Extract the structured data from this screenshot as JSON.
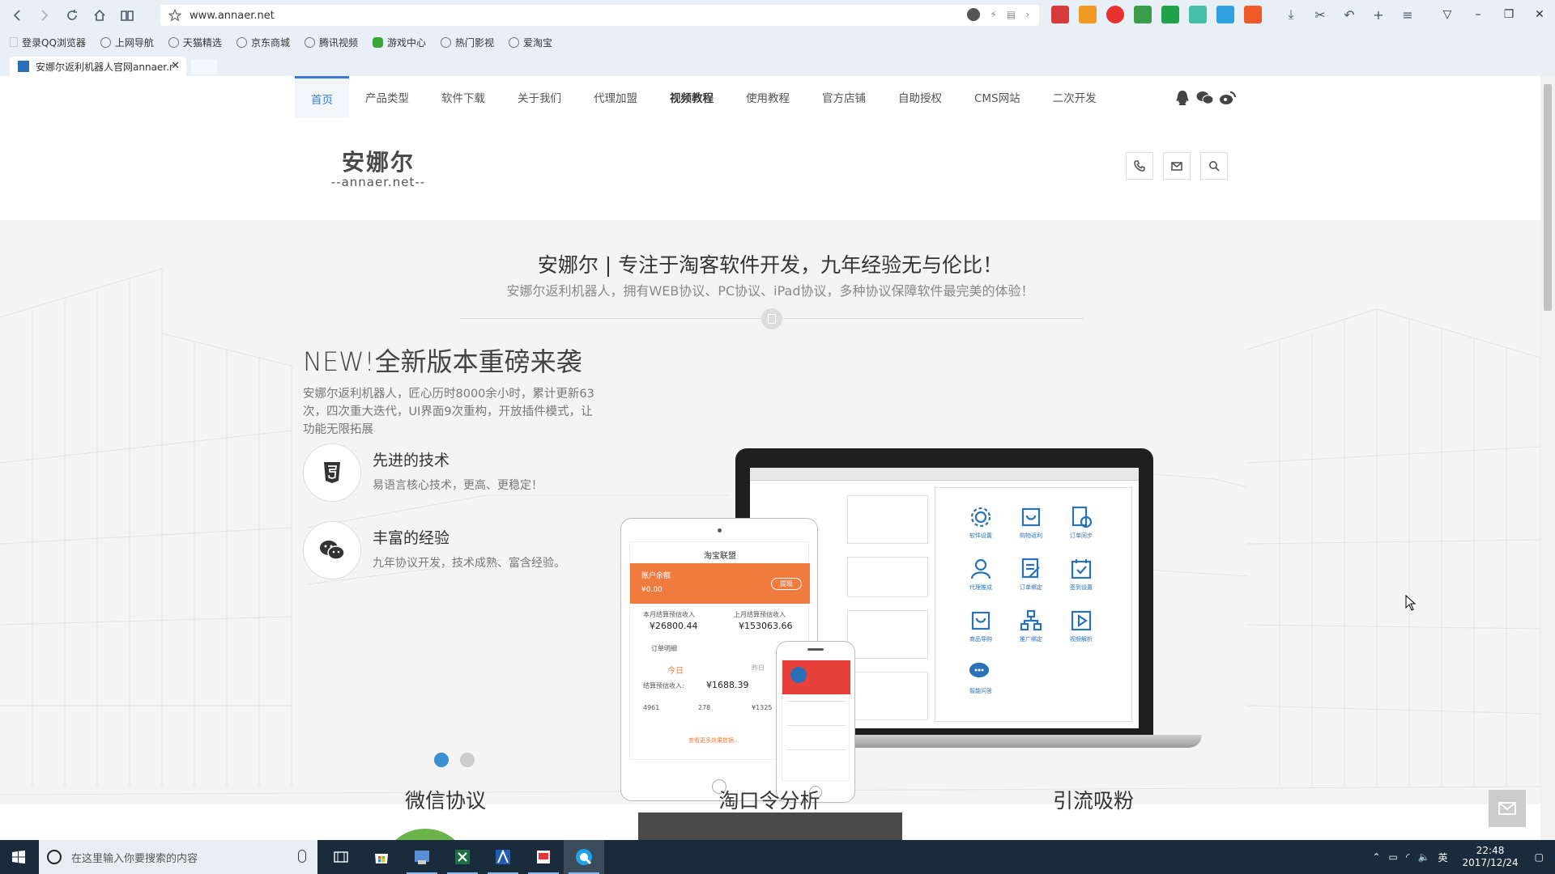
{
  "browser": {
    "url": "www.annaer.net",
    "bookmarks": [
      "登录QQ浏览器",
      "上网导航",
      "天猫精选",
      "京东商城",
      "腾讯视频",
      "游戏中心",
      "热门影视",
      "爱淘宝"
    ],
    "tab_title": "安娜尔返利机器人官网annaer.net",
    "tab_close": "✕"
  },
  "site": {
    "nav": [
      "首页",
      "产品类型",
      "软件下载",
      "关于我们",
      "代理加盟",
      "视频教程",
      "使用教程",
      "官方店铺",
      "自助授权",
      "CMS网站",
      "二次开发"
    ],
    "logo_cn": "安娜尔",
    "logo_en": "--annaer.net--",
    "hero": {
      "title": "安娜尔 | 专注于淘客软件开发，九年经验无与伦比！",
      "subtitle": "安娜尔返利机器人，拥有WEB协议、PC协议、iPad协议，多种协议保障软件最完美的体验！",
      "new_title": "NEW!全新版本重磅来袭",
      "new_desc": "安娜尔返利机器人，匠心历时8000余小时，累计更新63次，四次重大迭代，UI界面9次重构，开放插件模式，让功能无限拓展",
      "features": [
        {
          "title": "先进的技术",
          "desc": "易语言核心技术，更高、更稳定！"
        },
        {
          "title": "丰富的经验",
          "desc": "九年协议开发，技术成熟、富含经验。"
        }
      ]
    },
    "device": {
      "tablet_header": "淘宝联盟",
      "balance_label": "账户余额",
      "balance_value": "¥0.00",
      "withdraw": "提现",
      "this_month_label": "本月结算预估收入",
      "this_month_value": "¥26800.44",
      "last_month_label": "上月结算预估收入",
      "last_month_value": "¥153063.66",
      "orders_label": "订单明细",
      "today": "今日",
      "yesterday": "昨日",
      "settle_label": "结算预估收入:",
      "settle_value": "¥1688.39",
      "stat1": "4961",
      "stat2": "278",
      "stat3": "¥1325",
      "more": "查看更多效果数据...",
      "apps": [
        "软件设置",
        "购物返利",
        "订单同步",
        "代理推成",
        "订单绑定",
        "签到设置",
        "商品导购",
        "推广绑定",
        "视频解析",
        "智能问答"
      ]
    },
    "sections": [
      "微信协议",
      "淘口令分析",
      "引流吸粉"
    ]
  },
  "taskbar": {
    "search_placeholder": "在这里输入你要搜索的内容",
    "ime": "英",
    "time": "22:48",
    "date": "2017/12/24"
  }
}
